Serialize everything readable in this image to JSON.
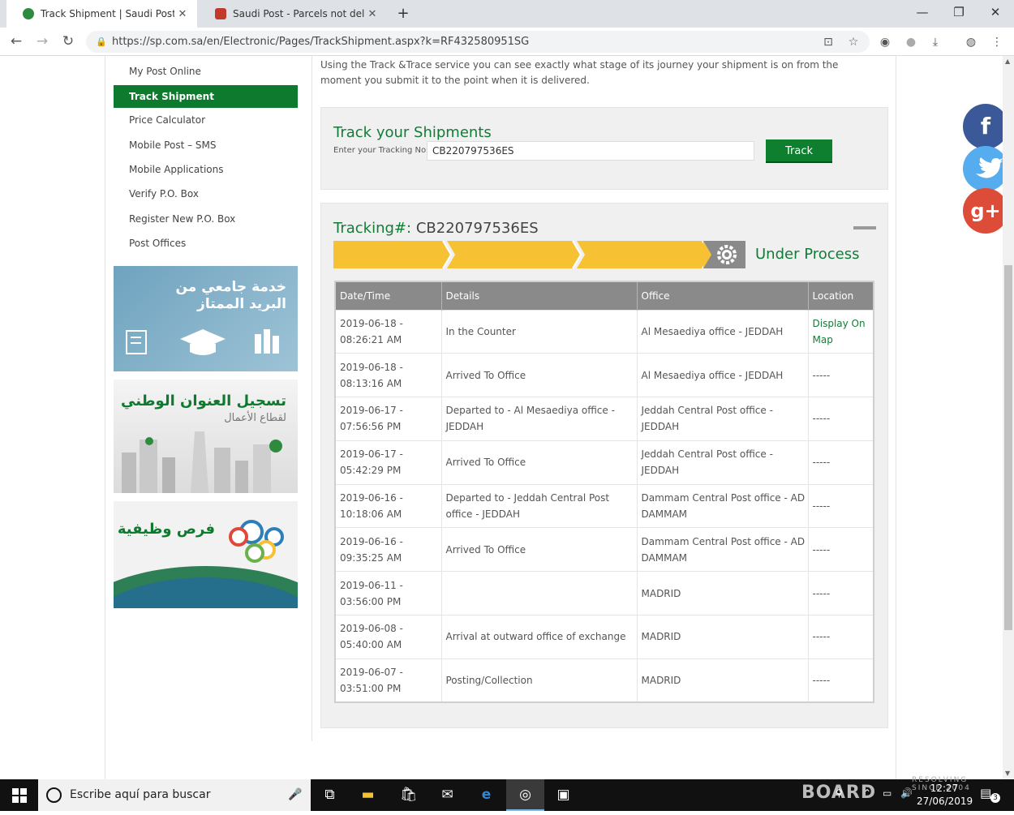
{
  "browser": {
    "tabs": [
      {
        "title": "Track Shipment | Saudi Post",
        "close": "✕"
      },
      {
        "title": "Saudi Post - Parcels not delivere",
        "close": "✕"
      }
    ],
    "new_tab": "+",
    "url": "https://sp.com.sa/en/Electronic/Pages/TrackShipment.aspx?k=RF432580951SG"
  },
  "sidebar": {
    "items": [
      {
        "label": "My Post Online"
      },
      {
        "label": "Track Shipment"
      },
      {
        "label": "Price Calculator"
      },
      {
        "label": "Mobile Post – SMS"
      },
      {
        "label": "Mobile Applications"
      },
      {
        "label": "Verify P.O. Box"
      },
      {
        "label": "Register New P.O. Box"
      },
      {
        "label": "Post Offices"
      }
    ],
    "banners": [
      {
        "line1": "خدمة جامعي من",
        "line2": "البريد الممتاز"
      },
      {
        "line1": "تسجيل العنوان الوطني",
        "line2": "لقطاع الأعمال"
      },
      {
        "line1": "فرص وظيفية"
      }
    ]
  },
  "intro": "Using the Track &Trace service you can see exactly what stage of its journey your shipment is on from the moment you submit it to the point when it is delivered.",
  "track_form": {
    "title": "Track your Shipments",
    "label": "Enter your Tracking No",
    "value": "CB220797536ES",
    "button": "Track"
  },
  "result": {
    "label": "Tracking#:",
    "number": "CB220797536ES",
    "status": "Under Process",
    "headers": [
      "Date/Time",
      "Details",
      "Office",
      "Location"
    ],
    "rows": [
      {
        "date": "2019-06-18 -",
        "time": "08:26:21 AM",
        "details": "In the Counter",
        "office": "Al Mesaediya office - JEDDAH",
        "location": "Display On Map"
      },
      {
        "date": "2019-06-18 -",
        "time": "08:13:16 AM",
        "details": "Arrived To Office",
        "office": "Al Mesaediya office - JEDDAH",
        "location": "-----"
      },
      {
        "date": "2019-06-17 -",
        "time": "07:56:56 PM",
        "details": "Departed to - Al Mesaediya office - JEDDAH",
        "office": "Jeddah Central Post office - JEDDAH",
        "location": "-----"
      },
      {
        "date": "2019-06-17 -",
        "time": "05:42:29 PM",
        "details": "Arrived To Office",
        "office": "Jeddah Central Post office - JEDDAH",
        "location": "-----"
      },
      {
        "date": "2019-06-16 -",
        "time": "10:18:06 AM",
        "details": "Departed to - Jeddah Central Post office - JEDDAH",
        "office": "Dammam Central Post office - AD DAMMAM",
        "location": "-----"
      },
      {
        "date": "2019-06-16 -",
        "time": "09:35:25 AM",
        "details": "Arrived To Office",
        "office": "Dammam Central Post office - AD DAMMAM",
        "location": "-----"
      },
      {
        "date": "2019-06-11 -",
        "time": "03:56:00 PM",
        "details": "",
        "office": "MADRID",
        "location": "-----"
      },
      {
        "date": "2019-06-08 -",
        "time": "05:40:00 AM",
        "details": "Arrival at outward office of exchange",
        "office": "MADRID",
        "location": "-----"
      },
      {
        "date": "2019-06-07 -",
        "time": "03:51:00 PM",
        "details": "Posting/Collection",
        "office": "MADRID",
        "location": "-----"
      }
    ]
  },
  "social": [
    "f",
    "g+"
  ],
  "taskbar": {
    "search_placeholder": "Escribe aquí para buscar",
    "time": "12:27",
    "date": "27/06/2019",
    "notifications": "3"
  },
  "watermark": {
    "brand": "BOARD",
    "tagline1": "RESOLVING",
    "tagline2": "SINCE 2004"
  },
  "colors": {
    "primary_green": "#0d7a2e",
    "progress_yellow": "#f6c233",
    "facebook": "#3b5998",
    "twitter": "#55acee",
    "google": "#dd4b39"
  }
}
